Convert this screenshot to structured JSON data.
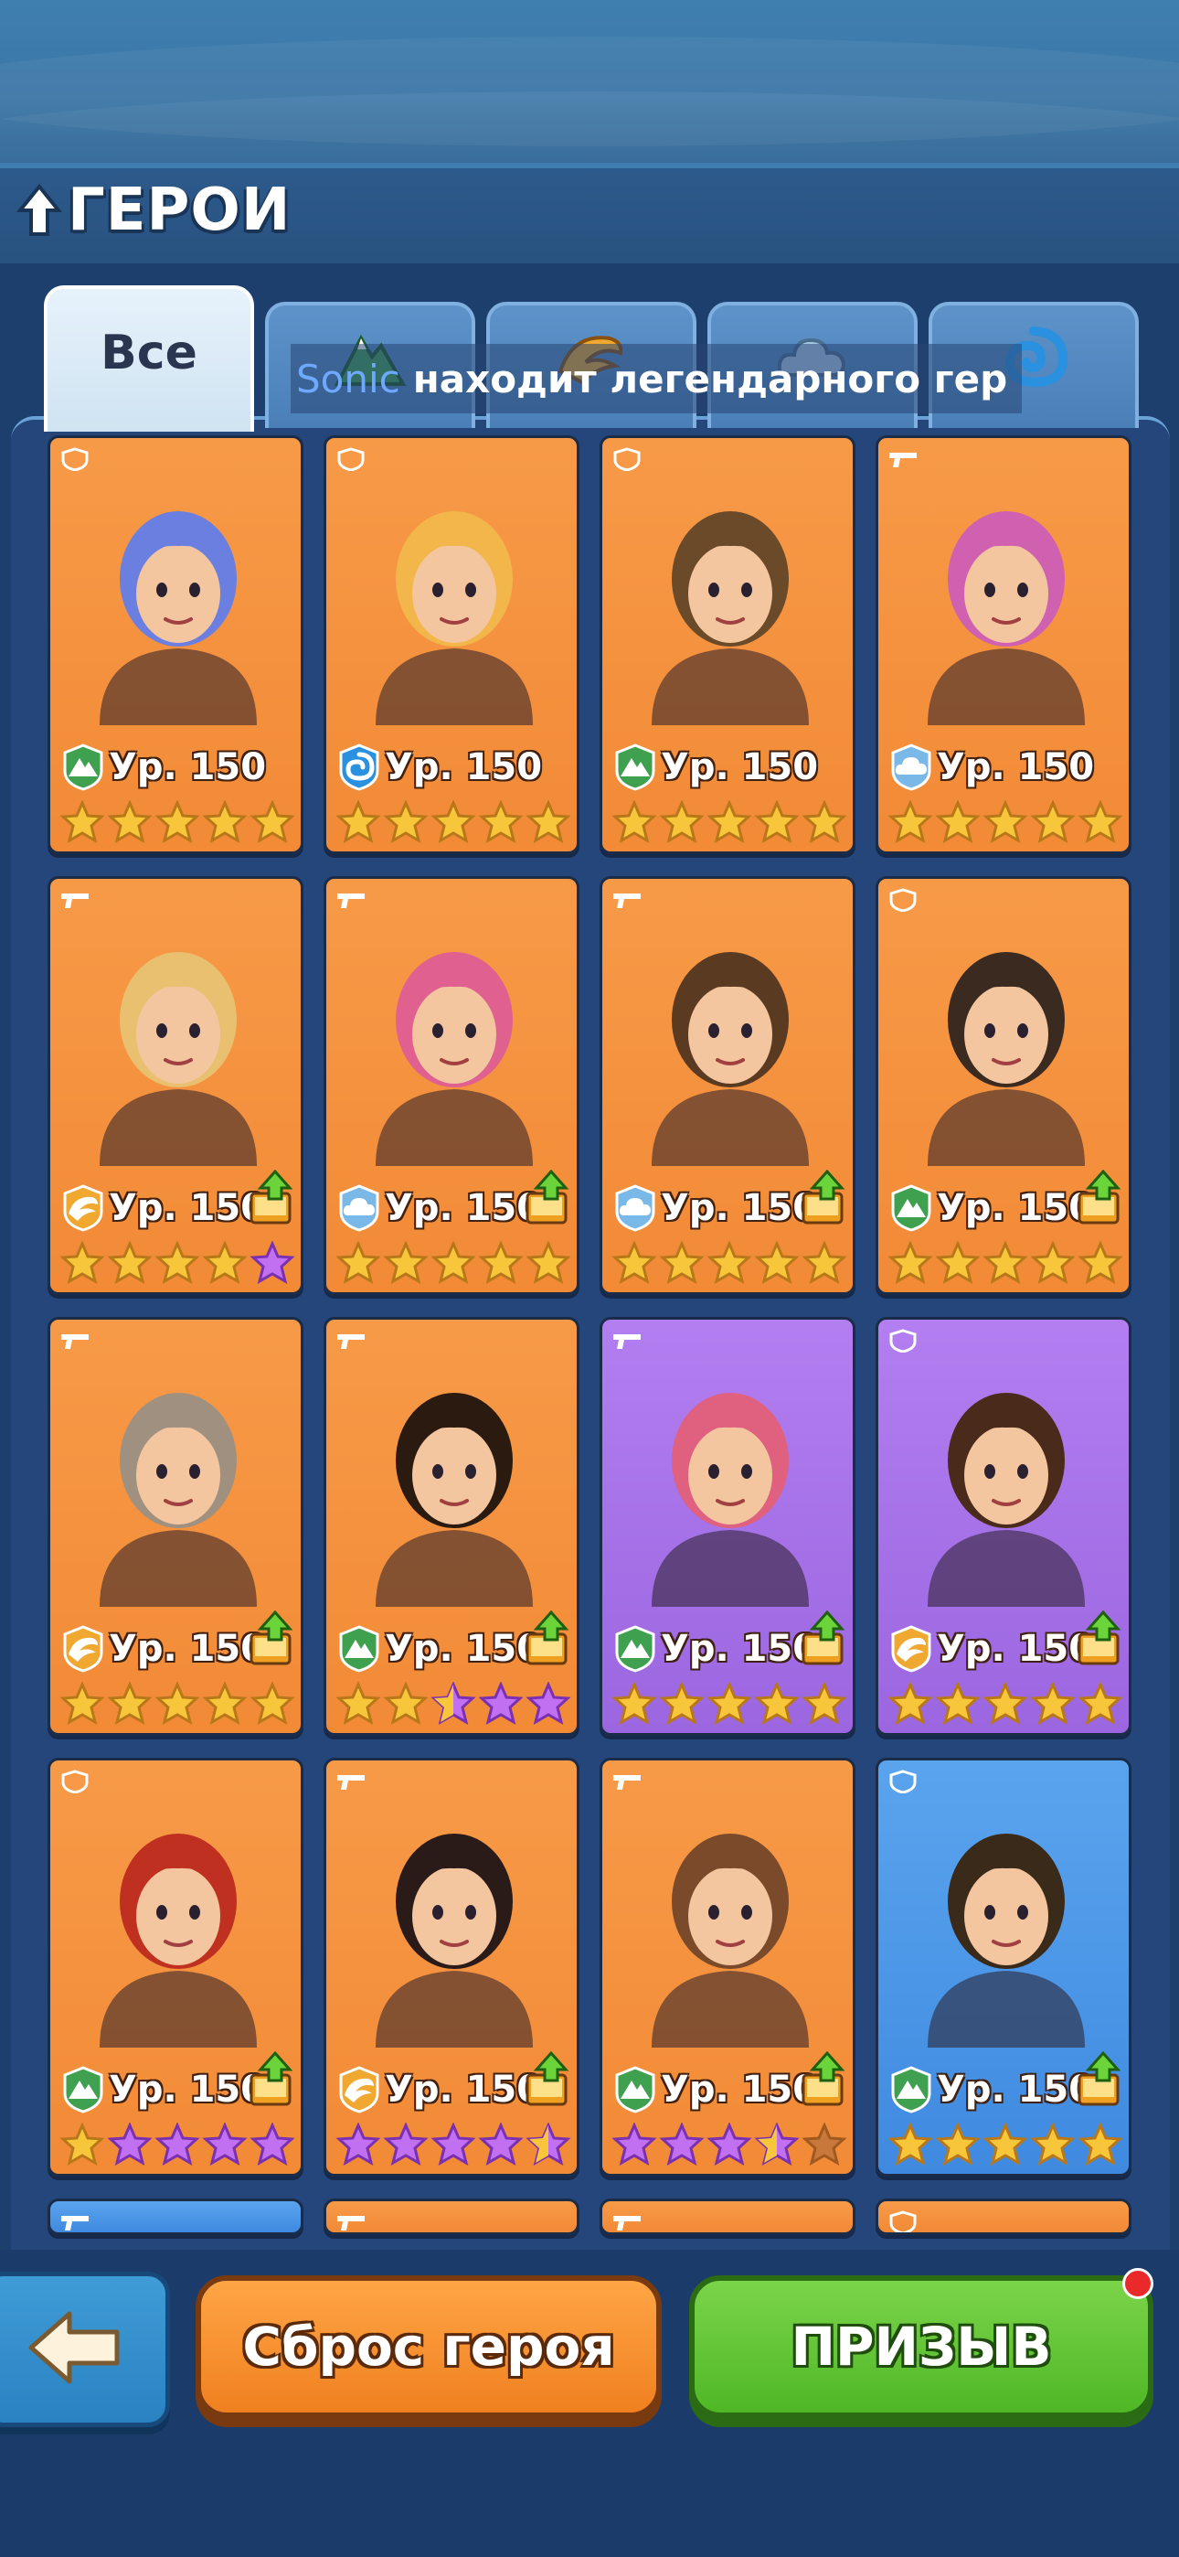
{
  "header": {
    "title": "ГЕРОИ"
  },
  "tabs": [
    {
      "label": "Все",
      "icon": "all"
    },
    {
      "label": "",
      "icon": "mountain-icon"
    },
    {
      "label": "",
      "icon": "claw-icon"
    },
    {
      "label": "",
      "icon": "cloud-icon"
    },
    {
      "label": "",
      "icon": "water-icon"
    }
  ],
  "ticker": {
    "name": "Sonic",
    "text": "находит легендарного гер"
  },
  "heroes": [
    {
      "level": "Ур. 150",
      "element": "mountain",
      "role": "shield",
      "bg": "orange",
      "stars": [
        "g",
        "g",
        "g",
        "g",
        "g"
      ],
      "upgrade": false,
      "hair": "#6b7fe0"
    },
    {
      "level": "Ур. 150",
      "element": "water",
      "role": "shield",
      "bg": "orange",
      "stars": [
        "g",
        "g",
        "g",
        "g",
        "g"
      ],
      "upgrade": false,
      "hair": "#f2b64a"
    },
    {
      "level": "Ур. 150",
      "element": "mountain",
      "role": "shield",
      "bg": "orange",
      "stars": [
        "g",
        "g",
        "g",
        "g",
        "g"
      ],
      "upgrade": false,
      "hair": "#6b4a2a"
    },
    {
      "level": "Ур. 150",
      "element": "cloud",
      "role": "gun",
      "bg": "orange",
      "stars": [
        "g",
        "g",
        "g",
        "g",
        "g"
      ],
      "upgrade": false,
      "hair": "#d060b0"
    },
    {
      "level": "Ур. 150",
      "element": "claw",
      "role": "gun",
      "bg": "orange",
      "stars": [
        "g",
        "g",
        "g",
        "g",
        "p"
      ],
      "upgrade": true,
      "hair": "#e8c070"
    },
    {
      "level": "Ур. 150",
      "element": "cloud",
      "role": "gun",
      "bg": "orange",
      "stars": [
        "g",
        "g",
        "g",
        "g",
        "g"
      ],
      "upgrade": true,
      "hair": "#e06090"
    },
    {
      "level": "Ур. 150",
      "element": "cloud",
      "role": "gun",
      "bg": "orange",
      "stars": [
        "g",
        "g",
        "g",
        "g",
        "g"
      ],
      "upgrade": true,
      "hair": "#5a3a20"
    },
    {
      "level": "Ур. 150",
      "element": "mountain",
      "role": "shield",
      "bg": "orange",
      "stars": [
        "g",
        "g",
        "g",
        "g",
        "g"
      ],
      "upgrade": true,
      "hair": "#3a2a20"
    },
    {
      "level": "Ур. 150",
      "element": "claw",
      "role": "gun",
      "bg": "orange",
      "stars": [
        "g",
        "g",
        "g",
        "g",
        "g"
      ],
      "upgrade": true,
      "hair": "#a09080"
    },
    {
      "level": "Ур. 150",
      "element": "mountain",
      "role": "gun",
      "bg": "orange",
      "stars": [
        "g",
        "g",
        "h",
        "p",
        "p"
      ],
      "upgrade": true,
      "hair": "#2a1a10"
    },
    {
      "level": "Ур. 150",
      "element": "mountain",
      "role": "gun",
      "bg": "purple",
      "stars": [
        "g",
        "g",
        "g",
        "g",
        "g"
      ],
      "upgrade": true,
      "hair": "#e06080"
    },
    {
      "level": "Ур. 150",
      "element": "claw",
      "role": "shield",
      "bg": "purple",
      "stars": [
        "g",
        "g",
        "g",
        "g",
        "g"
      ],
      "upgrade": true,
      "hair": "#4a2a1a"
    },
    {
      "level": "Ур. 150",
      "element": "mountain",
      "role": "shield",
      "bg": "orange",
      "stars": [
        "g",
        "p",
        "p",
        "p",
        "p"
      ],
      "upgrade": true,
      "hair": "#c03020"
    },
    {
      "level": "Ур. 150",
      "element": "claw",
      "role": "gun",
      "bg": "orange",
      "stars": [
        "p",
        "p",
        "p",
        "p",
        "h"
      ],
      "upgrade": true,
      "hair": "#2a1a18"
    },
    {
      "level": "Ур. 150",
      "element": "mountain",
      "role": "gun",
      "bg": "orange",
      "stars": [
        "p",
        "p",
        "p",
        "h",
        "e"
      ],
      "upgrade": true,
      "hair": "#7a4a2a"
    },
    {
      "level": "Ур. 150",
      "element": "mountain",
      "role": "shield",
      "bg": "blue",
      "stars": [
        "g",
        "g",
        "g",
        "g",
        "g"
      ],
      "upgrade": true,
      "hair": "#3a2a1a"
    }
  ],
  "partial_row": [
    {
      "role": "gun",
      "bg": "blue"
    },
    {
      "role": "gun",
      "bg": "orange"
    },
    {
      "role": "gun",
      "bg": "orange"
    },
    {
      "role": "shield",
      "bg": "orange"
    }
  ],
  "buttons": {
    "back": "back-arrow-icon",
    "reset_label": "Сброс героя",
    "summon_label": "ПРИЗЫВ"
  },
  "colors": {
    "orange_card": "#f28a36",
    "purple_card": "#9b66e0",
    "blue_card": "#3f8ae0",
    "summon_green": "#4fb726",
    "reset_orange": "#f08020",
    "gold_star": "#f7c63a",
    "purple_star": "#c070f0"
  }
}
